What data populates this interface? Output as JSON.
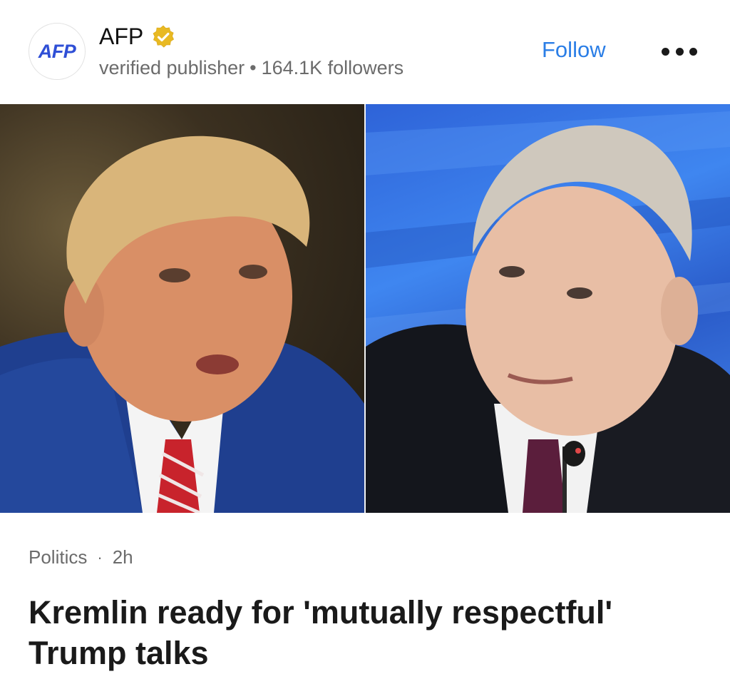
{
  "publisher": {
    "avatar_text": "AFP",
    "name": "AFP",
    "verified_badge_color": "#e8b923",
    "status": "verified publisher",
    "separator": "•",
    "followers": "164.1K followers"
  },
  "actions": {
    "follow_label": "Follow",
    "follow_color": "#2b7ee6",
    "more_icon": "more-horizontal-icon"
  },
  "article": {
    "category": "Politics",
    "separator": "·",
    "age": "2h",
    "headline": "Kremlin ready for 'mutually respectful' Trump talks"
  }
}
